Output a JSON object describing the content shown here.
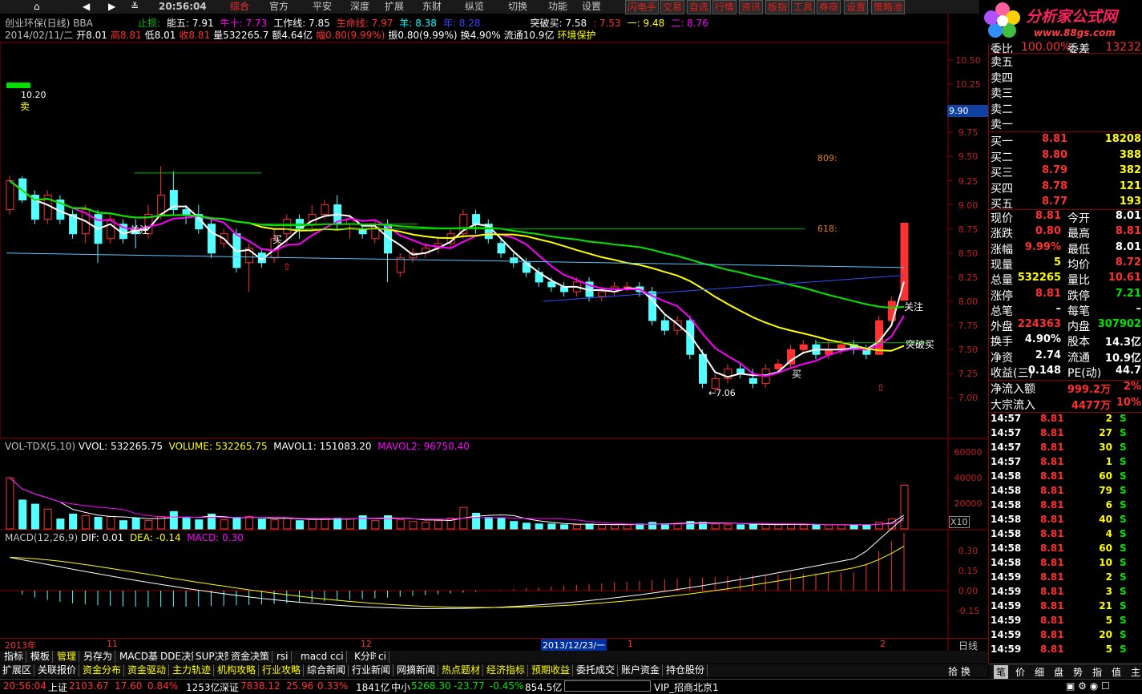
{
  "topbar": {
    "time": "20:56:04",
    "menus": [
      "综合",
      "官方",
      "平安",
      "深度",
      "扩展",
      "东财",
      "纵览",
      "切换",
      "功能",
      "设置"
    ],
    "right_buttons": [
      "闪电手",
      "交易",
      "自选",
      "行情",
      "资讯",
      "板指",
      "工具",
      "券商",
      "设置",
      "策略池"
    ]
  },
  "logo": {
    "title": "分析家公式网",
    "url": "www.88gs.com"
  },
  "header": {
    "stock": "创业环保(日线)",
    "tag": "BBA",
    "line1": [
      {
        "t": "止损:",
        "c": "#00c000"
      },
      {
        "t": "能五: 7.91",
        "c": "#ffffff"
      },
      {
        "t": "牛十: 7.73",
        "c": "#ff00ff"
      },
      {
        "t": "工作线: 7.85",
        "c": "#ffffff"
      },
      {
        "t": "生命线: 7.97",
        "c": "#ff3030"
      },
      {
        "t": "羊: 8.38",
        "c": "#00ffff"
      },
      {
        "t": "年: 8.28",
        "c": "#4040ff"
      },
      {
        "t": "突破买: 7.58",
        "c": "#ffffff"
      },
      {
        "t": ": 7.53",
        "c": "#ff3030"
      },
      {
        "t": "一: 9.48",
        "c": "#ffff00"
      },
      {
        "t": "二: 8.76",
        "c": "#ff00ff"
      }
    ],
    "line2": [
      {
        "t": "2014/02/11/二",
        "c": "#c0c0c0"
      },
      {
        "t": "开8.01",
        "c": "#ffffff"
      },
      {
        "t": "高8.81",
        "c": "#ff3030"
      },
      {
        "t": "低8.01",
        "c": "#ffffff"
      },
      {
        "t": "收8.81",
        "c": "#ff3030"
      },
      {
        "t": "量532265.7",
        "c": "#ffffff"
      },
      {
        "t": "额4.64亿",
        "c": "#ffffff"
      },
      {
        "t": "幅0.80(9.99%)",
        "c": "#ff3030"
      },
      {
        "t": "振0.80(9.99%)",
        "c": "#ffffff"
      },
      {
        "t": "换4.90%",
        "c": "#ffffff"
      },
      {
        "t": "流通10.9亿",
        "c": "#ffffff"
      },
      {
        "t": "环境保护",
        "c": "#ffff00"
      }
    ]
  },
  "price_axis": [
    "10.50",
    "10.25",
    "10.00",
    "9.75",
    "9.50",
    "9.25",
    "9.00",
    "8.75",
    "8.50",
    "8.25",
    "8.00",
    "7.75",
    "7.50",
    "7.25",
    "7.00"
  ],
  "price_cursor": "9.90",
  "annotations": {
    "high_label": "10.20",
    "sell": "卖",
    "low_label": "←7.06",
    "fib809": "809:",
    "fib618": "618:",
    "guanzhu1": "关注",
    "buy1": "买",
    "guanzhu2": "关注",
    "buy2": "买",
    "tupomai": "突破买"
  },
  "vol": {
    "title": "VOL-TDX(5,10)",
    "vvol": "VVOL: 532265.75",
    "volume": "VOLUME: 532265.75",
    "mavol1": "MAVOL1: 151083.20",
    "mavol2": "MAVOL2: 96750.40",
    "axis": [
      "60000",
      "40000",
      "20000"
    ],
    "unit": "X10"
  },
  "macd": {
    "title": "MACD(12,26,9)",
    "dif": "DIF: 0.01",
    "dea": "DEA: -0.14",
    "macd": "MACD: 0.30",
    "axis": [
      "0.30",
      "0.15",
      "0.00",
      "-0.15"
    ]
  },
  "date_axis": {
    "labels": [
      "2013年",
      "11",
      "12",
      "2013/12/23/一",
      "1",
      "2"
    ],
    "period": "日线"
  },
  "bottom_tabs": [
    "指标",
    "模板",
    "管理",
    "另存为",
    "MACD基本",
    "DDE决策",
    "SUP决策",
    "资金决策",
    "rsi",
    "macd",
    "cci",
    "K分时",
    "ci"
  ],
  "func_tabs": [
    "扩展区",
    "关联报价",
    "资金分布",
    "资金驱动",
    "主力轨迹",
    "机构攻略",
    "行业攻略",
    "综合新闻",
    "行业新闻",
    "网摘新闻",
    "热点题材",
    "经济指标",
    "预期收益",
    "委托成交",
    "账户资金",
    "持仓股份"
  ],
  "panel": {
    "top": [
      {
        "l": "委比",
        "v": "100.00%",
        "l2": "委差",
        "v2": "13232"
      }
    ],
    "sells": [
      "卖五",
      "卖四",
      "卖三",
      "卖二",
      "卖一"
    ],
    "buys": [
      {
        "l": "买一",
        "p": "8.81",
        "q": "18208"
      },
      {
        "l": "买二",
        "p": "8.80",
        "q": "388"
      },
      {
        "l": "买三",
        "p": "8.79",
        "q": "382"
      },
      {
        "l": "买四",
        "p": "8.78",
        "q": "121"
      },
      {
        "l": "买五",
        "p": "8.77",
        "q": "193"
      }
    ],
    "stats": [
      {
        "l": "现价",
        "v": "8.81",
        "vc": "#ff3030",
        "l2": "今开",
        "v2": "8.01",
        "v2c": "#ffffff"
      },
      {
        "l": "涨跌",
        "v": "0.80",
        "vc": "#ff3030",
        "l2": "最高",
        "v2": "8.81",
        "v2c": "#ff3030"
      },
      {
        "l": "涨幅",
        "v": "9.99%",
        "vc": "#ff3030",
        "l2": "最低",
        "v2": "8.01",
        "v2c": "#ffffff"
      },
      {
        "l": "现量",
        "v": "5",
        "vc": "#ffff00",
        "l2": "均价",
        "v2": "8.72",
        "v2c": "#ff3030"
      },
      {
        "l": "总量",
        "v": "532265",
        "vc": "#ffff00",
        "l2": "量比",
        "v2": "10.61",
        "v2c": "#ff3030"
      },
      {
        "l": "涨停",
        "v": "8.81",
        "vc": "#ff3030",
        "l2": "跌停",
        "v2": "7.21",
        "v2c": "#00e600"
      },
      {
        "l": "总笔",
        "v": "–",
        "vc": "#ffffff",
        "l2": "每笔",
        "v2": "–",
        "v2c": "#ffffff"
      },
      {
        "l": "外盘",
        "v": "224363",
        "vc": "#ff3030",
        "l2": "内盘",
        "v2": "307902",
        "v2c": "#00e600"
      },
      {
        "l": "换手",
        "v": "4.90%",
        "vc": "#ffffff",
        "l2": "股本",
        "v2": "14.3亿",
        "v2c": "#ffffff"
      },
      {
        "l": "净资",
        "v": "2.74",
        "vc": "#ffffff",
        "l2": "流通",
        "v2": "10.9亿",
        "v2c": "#ffffff"
      },
      {
        "l": "收益(三)",
        "v": "0.148",
        "vc": "#ffffff",
        "l2": "PE(动)",
        "v2": "44.7",
        "v2c": "#ffffff"
      }
    ],
    "flows": [
      {
        "l": "净流入额",
        "v": "999.2万",
        "p": "2%"
      },
      {
        "l": "大宗流入",
        "v": "4477万",
        "p": "10%"
      }
    ],
    "ticks": [
      {
        "t": "14:57",
        "p": "8.81",
        "q": "2",
        "s": "S"
      },
      {
        "t": "14:57",
        "p": "8.81",
        "q": "27",
        "s": "S"
      },
      {
        "t": "14:57",
        "p": "8.81",
        "q": "30",
        "s": "S"
      },
      {
        "t": "14:57",
        "p": "8.81",
        "q": "1",
        "s": "S"
      },
      {
        "t": "14:58",
        "p": "8.81",
        "q": "60",
        "s": "S"
      },
      {
        "t": "14:58",
        "p": "8.81",
        "q": "79",
        "s": "S"
      },
      {
        "t": "14:58",
        "p": "8.81",
        "q": "6",
        "s": "S"
      },
      {
        "t": "14:58",
        "p": "8.81",
        "q": "40",
        "s": "S"
      },
      {
        "t": "14:58",
        "p": "8.81",
        "q": "4",
        "s": "S"
      },
      {
        "t": "14:58",
        "p": "8.81",
        "q": "60",
        "s": "S"
      },
      {
        "t": "14:58",
        "p": "8.81",
        "q": "10",
        "s": "S"
      },
      {
        "t": "14:59",
        "p": "8.81",
        "q": "2",
        "s": "S"
      },
      {
        "t": "14:59",
        "p": "8.81",
        "q": "3",
        "s": "S"
      },
      {
        "t": "14:59",
        "p": "8.81",
        "q": "21",
        "s": "S"
      },
      {
        "t": "14:59",
        "p": "8.81",
        "q": "5",
        "s": "S"
      },
      {
        "t": "14:59",
        "p": "8.81",
        "q": "20",
        "s": "S"
      },
      {
        "t": "14:59",
        "p": "8.81",
        "q": "5",
        "s": "S"
      }
    ],
    "bottom_tabs": [
      "笔",
      "价",
      "细",
      "盘",
      "势",
      "指",
      "值",
      "主"
    ]
  },
  "status": {
    "time": "20:56:04",
    "sh_label": "上证",
    "sh": "2103.67",
    "sh_chg": "17.60",
    "sh_pct": "0.84%",
    "sh_amt": "1253亿",
    "sz_label": "深证",
    "sz": "7838.12",
    "sz_chg": "25.96",
    "sz_pct": "0.33%",
    "sz_amt": "1841亿",
    "zx_label": "中小",
    "zx": "5268.30",
    "zx_chg": "-23.77",
    "zx_pct": "-0.45%",
    "zx_amt": "854.5亿",
    "vip": "VIP_招商北京1"
  },
  "colors": {
    "up": "#ff3232",
    "down": "#54ffff",
    "grid": "#8b0000",
    "ma5": "#ffffff",
    "ma10": "#ff00ff",
    "ma20": "#ffff00",
    "ma60": "#00e600",
    "ma120": "#54c8ff",
    "ma250": "#3050ff"
  }
}
